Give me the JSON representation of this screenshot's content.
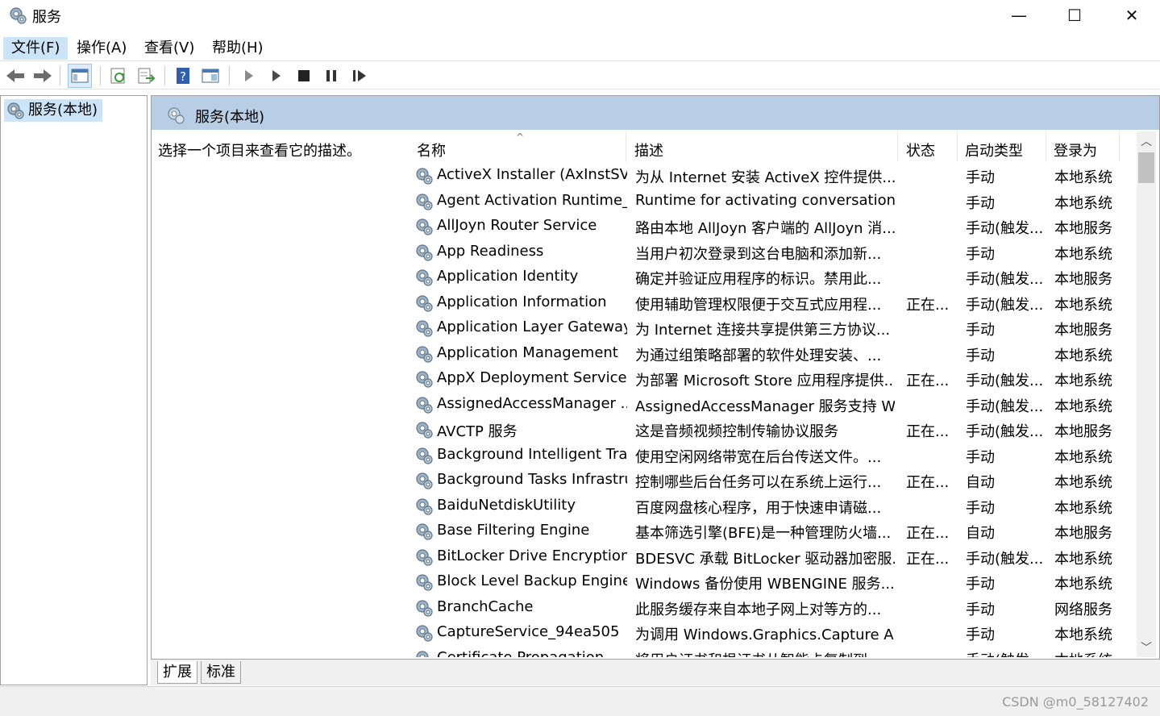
{
  "window": {
    "title": "服务",
    "minimize_glyph": "—",
    "maximize_glyph": "☐",
    "close_glyph": "✕"
  },
  "menu": [
    {
      "label": "文件(F)"
    },
    {
      "label": "操作(A)"
    },
    {
      "label": "查看(V)"
    },
    {
      "label": "帮助(H)"
    }
  ],
  "toolbar": {
    "icons": [
      "back-arrow-icon",
      "forward-arrow-icon",
      "show-hide-console-tree-icon",
      "refresh-icon",
      "export-list-icon",
      "help-icon",
      "properties-icon",
      "start-service-icon",
      "start-alt-icon",
      "stop-service-icon",
      "pause-service-icon",
      "restart-service-icon"
    ]
  },
  "tree": {
    "root_label": "服务(本地)"
  },
  "pane": {
    "title": "服务(本地)",
    "description_hint": "选择一个项目来查看它的描述。"
  },
  "columns": {
    "name": "名称",
    "description": "描述",
    "status": "状态",
    "startup_type": "启动类型",
    "logon_as": "登录为"
  },
  "services": [
    {
      "name": "ActiveX Installer (AxInstSV)",
      "description": "为从 Internet 安装 ActiveX 控件提供...",
      "status": "",
      "startup": "手动",
      "logon": "本地系统"
    },
    {
      "name": "Agent Activation Runtime_...",
      "description": "Runtime for activating conversational...",
      "status": "",
      "startup": "手动",
      "logon": "本地系统"
    },
    {
      "name": "AllJoyn Router Service",
      "description": "路由本地 AllJoyn 客户端的 AllJoyn 消...",
      "status": "",
      "startup": "手动(触发...",
      "logon": "本地服务"
    },
    {
      "name": "App Readiness",
      "description": "当用户初次登录到这台电脑和添加新...",
      "status": "",
      "startup": "手动",
      "logon": "本地系统"
    },
    {
      "name": "Application Identity",
      "description": "确定并验证应用程序的标识。禁用此...",
      "status": "",
      "startup": "手动(触发...",
      "logon": "本地服务"
    },
    {
      "name": "Application Information",
      "description": "使用辅助管理权限便于交互式应用程...",
      "status": "正在...",
      "startup": "手动(触发...",
      "logon": "本地系统"
    },
    {
      "name": "Application Layer Gateway ...",
      "description": "为 Internet 连接共享提供第三方协议...",
      "status": "",
      "startup": "手动",
      "logon": "本地服务"
    },
    {
      "name": "Application Management",
      "description": "为通过组策略部署的软件处理安装、...",
      "status": "",
      "startup": "手动",
      "logon": "本地系统"
    },
    {
      "name": "AppX Deployment Service ...",
      "description": "为部署 Microsoft Store 应用程序提供...",
      "status": "正在...",
      "startup": "手动(触发...",
      "logon": "本地系统"
    },
    {
      "name": "AssignedAccessManager ...",
      "description": "AssignedAccessManager 服务支持 Wi...",
      "status": "",
      "startup": "手动(触发...",
      "logon": "本地系统"
    },
    {
      "name": "AVCTP 服务",
      "description": "这是音频视频控制传输协议服务",
      "status": "正在...",
      "startup": "手动(触发...",
      "logon": "本地服务"
    },
    {
      "name": "Background Intelligent Tra...",
      "description": "使用空闲网络带宽在后台传送文件。...",
      "status": "",
      "startup": "手动",
      "logon": "本地系统"
    },
    {
      "name": "Background Tasks Infrastru...",
      "description": "控制哪些后台任务可以在系统上运行...",
      "status": "正在...",
      "startup": "自动",
      "logon": "本地系统"
    },
    {
      "name": "BaiduNetdiskUtility",
      "description": "百度网盘核心程序，用于快速申请磁...",
      "status": "",
      "startup": "手动",
      "logon": "本地系统"
    },
    {
      "name": "Base Filtering Engine",
      "description": "基本筛选引擎(BFE)是一种管理防火墙...",
      "status": "正在...",
      "startup": "自动",
      "logon": "本地服务"
    },
    {
      "name": "BitLocker Drive Encryption ...",
      "description": "BDESVC 承载 BitLocker 驱动器加密服...",
      "status": "正在...",
      "startup": "手动(触发...",
      "logon": "本地系统"
    },
    {
      "name": "Block Level Backup Engine ...",
      "description": "Windows 备份使用 WBENGINE 服务...",
      "status": "",
      "startup": "手动",
      "logon": "本地系统"
    },
    {
      "name": "BranchCache",
      "description": "此服务缓存来自本地子网上对等方的...",
      "status": "",
      "startup": "手动",
      "logon": "网络服务"
    },
    {
      "name": "CaptureService_94ea505",
      "description": "为调用 Windows.Graphics.Capture AP...",
      "status": "",
      "startup": "手动",
      "logon": "本地系统"
    },
    {
      "name": "Certificate Propagation",
      "description": "将用户证书和根证书从智能卡复制到...",
      "status": "",
      "startup": "手动(触发...",
      "logon": "本地系统"
    }
  ],
  "bottom_tabs": [
    {
      "label": "扩展"
    },
    {
      "label": "标准"
    }
  ],
  "watermark": "CSDN @m0_58127402"
}
